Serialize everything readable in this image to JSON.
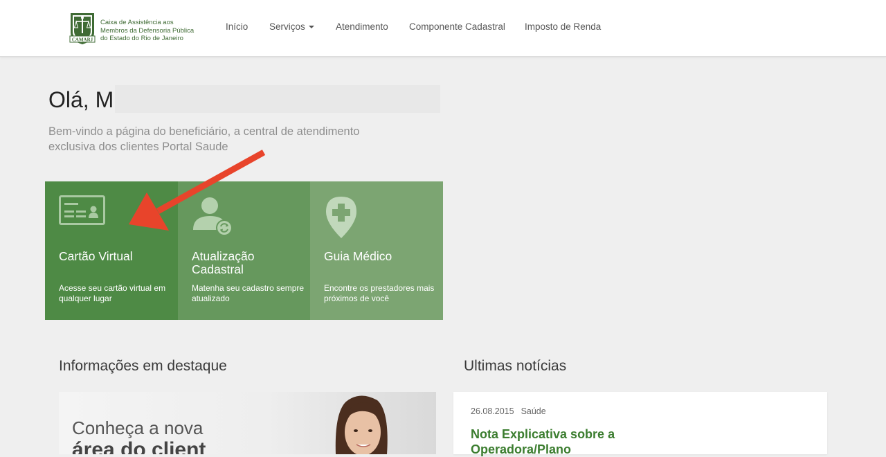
{
  "brand": {
    "logo_acronym": "CAMARJ",
    "lines": [
      "Caixa de Assistência aos",
      "Membros da Defensoria Pública",
      "do Estado do Rio de Janeiro"
    ]
  },
  "nav": {
    "inicio": "Início",
    "servicos": "Serviços",
    "atendimento": "Atendimento",
    "componente": "Componente Cadastral",
    "imposto": "Imposto de Renda"
  },
  "greeting": "Olá, M",
  "subtitle": "Bem-vindo a página do beneficiário, a central de atendimento exclusiva dos clientes Portal Saude",
  "tiles": [
    {
      "title": "Cartão Virtual",
      "desc": "Acesse seu cartão virtual em qualquer lugar",
      "color": "#4e8a45",
      "icon": "id-card-icon"
    },
    {
      "title": "Atualização Cadastral",
      "desc": "Matenha seu cadastro sempre atualizado",
      "color": "#66985d",
      "icon": "user-refresh-icon"
    },
    {
      "title": "Guia Médico",
      "desc": "Encontre os prestadores mais próximos de você",
      "color": "#7ca572",
      "icon": "medical-pin-icon"
    }
  ],
  "sections": {
    "highlights": "Informações em destaque",
    "news": "Ultimas notícias"
  },
  "banner": {
    "line1": "Conheça a nova",
    "line2": "área do client"
  },
  "news": {
    "date": "26.08.2015",
    "category": "Saúde",
    "title": "Nota Explicativa sobre a",
    "title2": "Operadora/Plano"
  },
  "colors": {
    "accent_arrow": "#e8442b",
    "news_title": "#3b7d2f"
  }
}
